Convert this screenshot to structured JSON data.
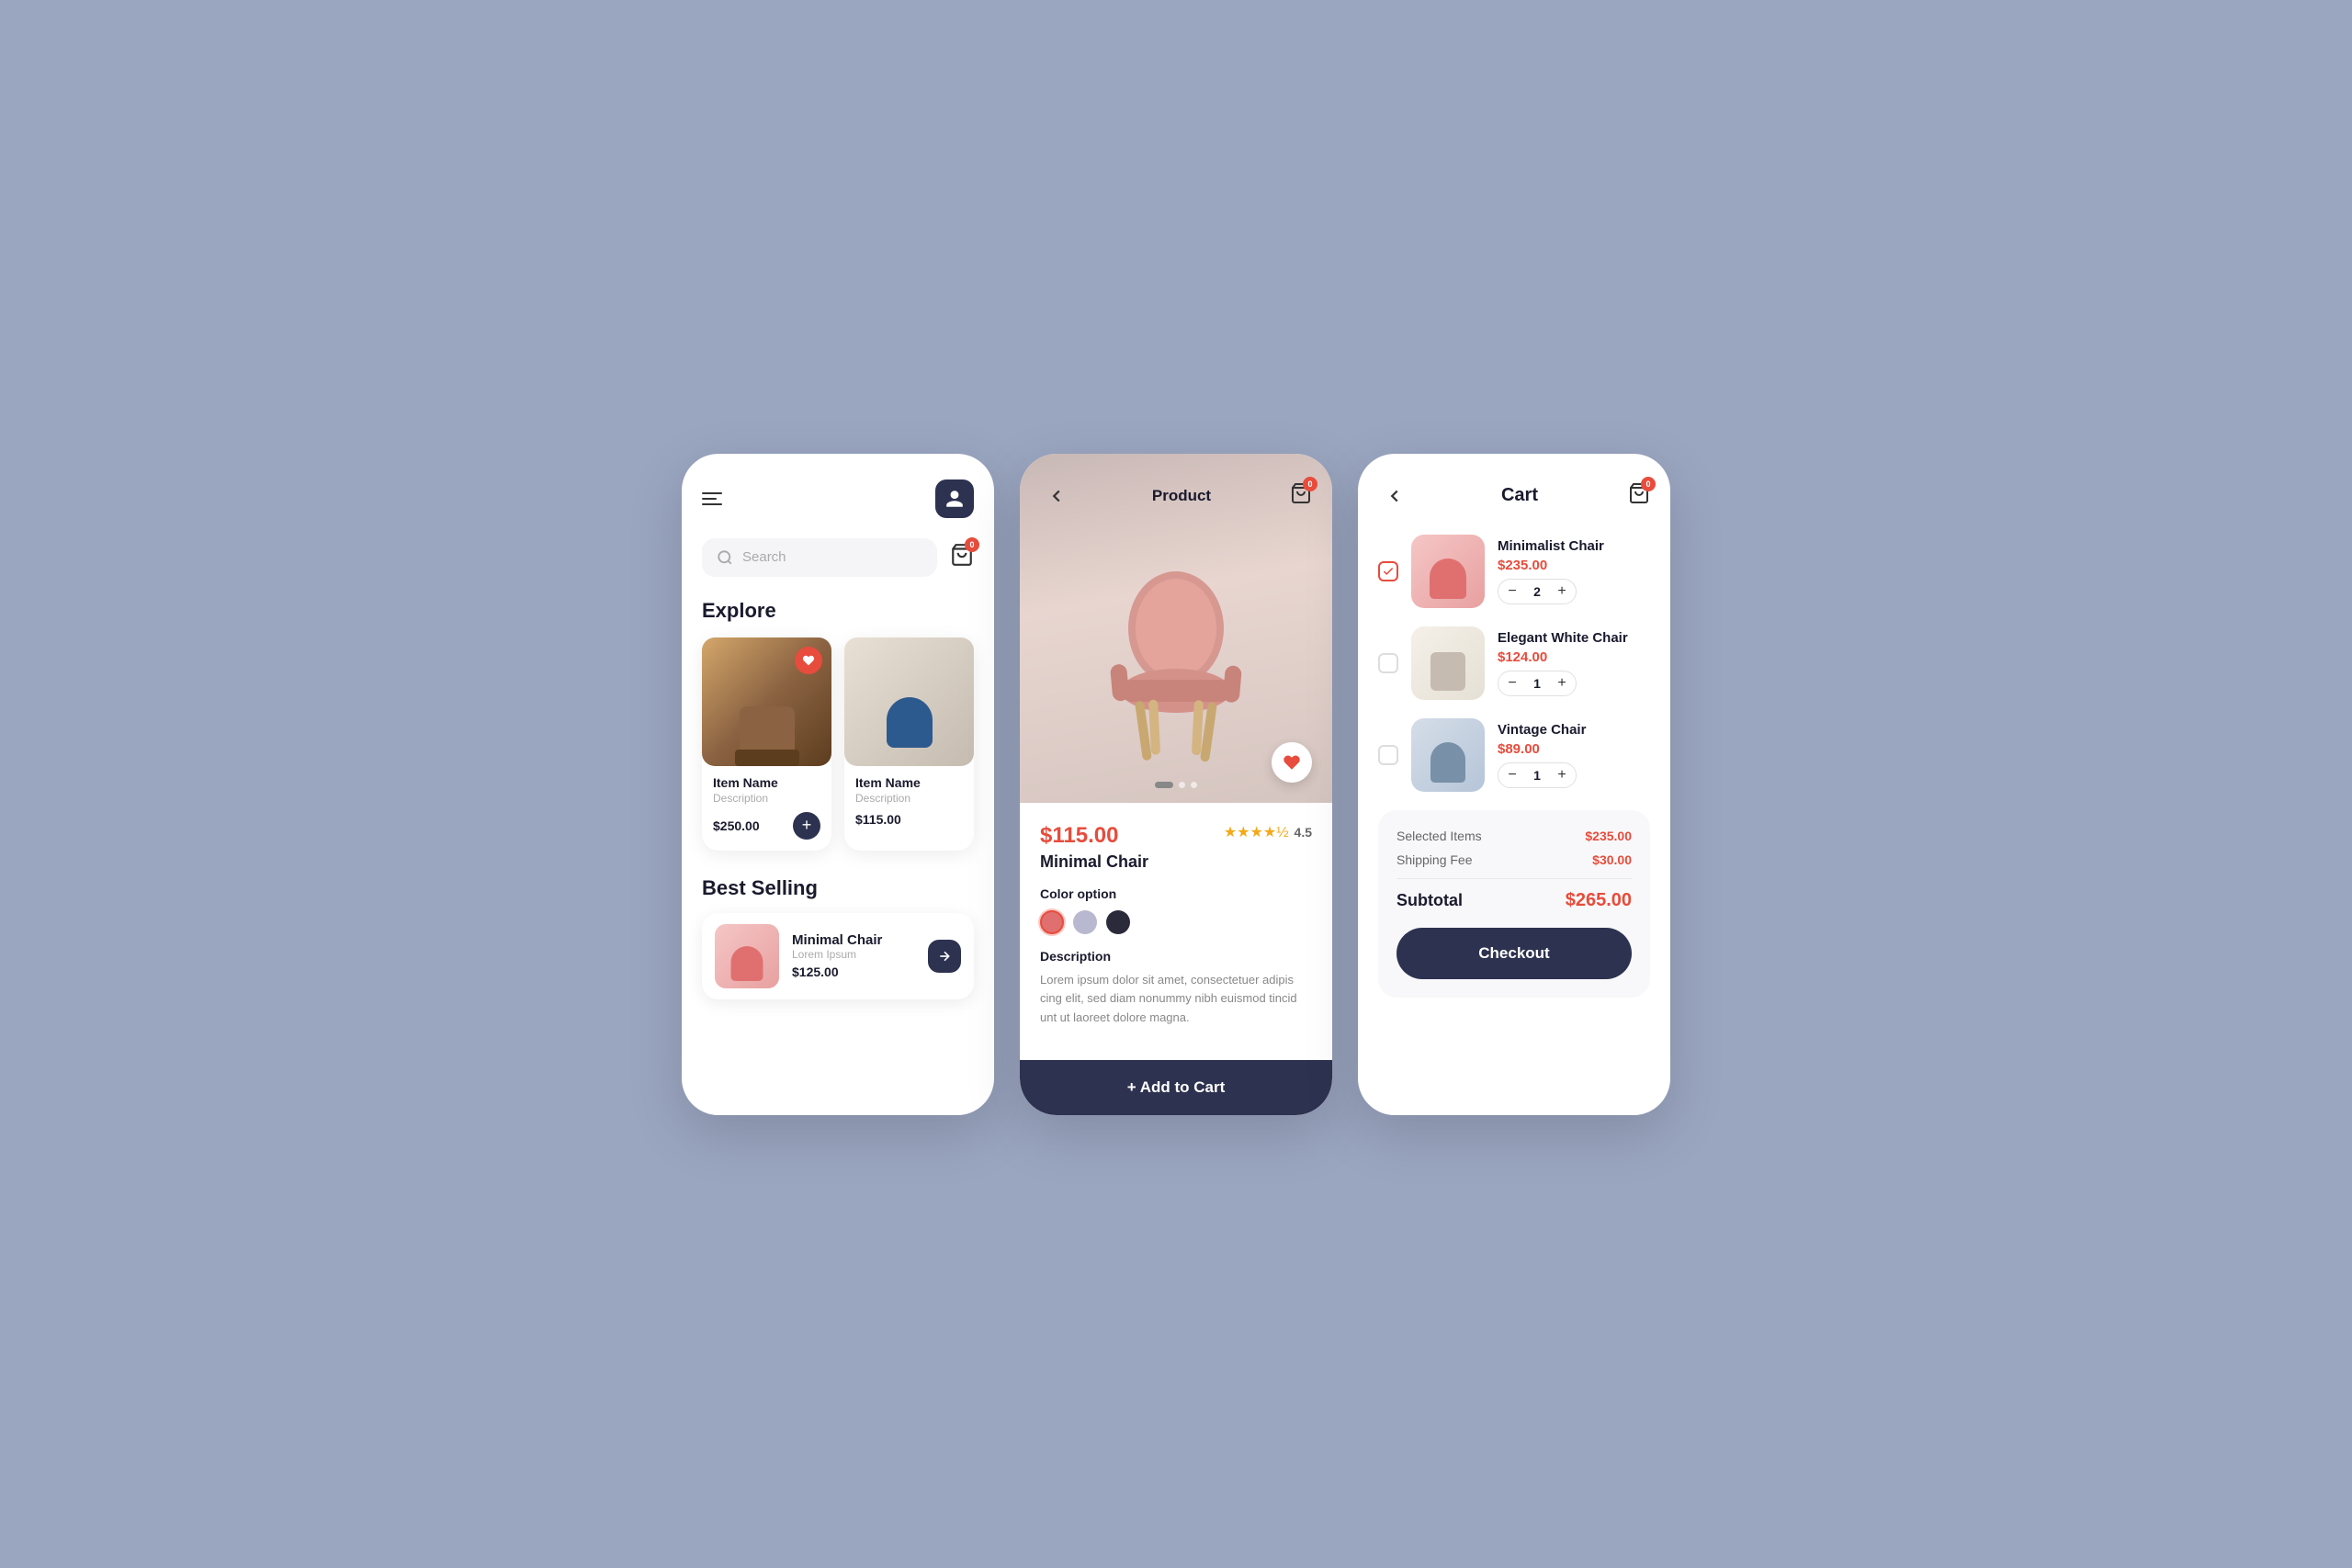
{
  "app": {
    "background_color": "#9aa5c0"
  },
  "screen_home": {
    "header": {
      "menu_label": "menu",
      "profile_label": "profile"
    },
    "search": {
      "placeholder": "Search"
    },
    "cart_badge": "0",
    "explore": {
      "title": "Explore",
      "items": [
        {
          "name": "Item Name",
          "description": "Description",
          "price": "$250.00",
          "favorited": true
        },
        {
          "name": "Item Name",
          "description": "Description",
          "price": "$115.00",
          "favorited": false
        }
      ]
    },
    "best_selling": {
      "title": "Best Selling",
      "items": [
        {
          "name": "Minimal Chair",
          "description": "Lorem Ipsum",
          "price": "$125.00"
        }
      ]
    }
  },
  "screen_product": {
    "title": "Product",
    "price": "$115.00",
    "name": "Minimal Chair",
    "rating": "4.5",
    "color_option_label": "Color option",
    "colors": [
      "#e07070",
      "#b8b8d0",
      "#2a2a3a"
    ],
    "selected_color_index": 0,
    "description_label": "Description",
    "description_text": "Lorem ipsum dolor sit amet, consectetuer adipis cing elit, sed diam nonummy nibh euismod tincid unt ut laoreet dolore magna.",
    "add_to_cart_label": "+ Add to Cart"
  },
  "screen_cart": {
    "title": "Cart",
    "cart_badge": "0",
    "items": [
      {
        "name": "Minimalist Chair",
        "price": "$235.00",
        "quantity": 2,
        "checked": true
      },
      {
        "name": "Elegant White Chair",
        "price": "$124.00",
        "quantity": 1,
        "checked": false
      },
      {
        "name": "Vintage Chair",
        "price": "$89.00",
        "quantity": 1,
        "checked": false
      }
    ],
    "summary": {
      "selected_items_label": "Selected Items",
      "selected_items_value": "$235.00",
      "shipping_fee_label": "Shipping Fee",
      "shipping_fee_value": "$30.00",
      "subtotal_label": "Subtotal",
      "subtotal_value": "$265.00"
    },
    "checkout_label": "Checkout"
  }
}
